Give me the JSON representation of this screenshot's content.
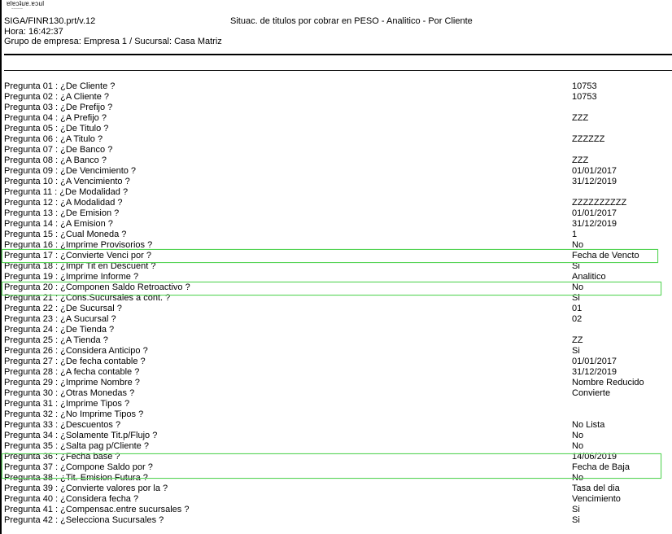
{
  "header": {
    "report_id": "SIGA/FINR130.prt/v.12",
    "title": "Situac. de titulos por cobrar en PESO - Analitico - Por Cliente",
    "time": "Hora: 16:42:37",
    "group": "Grupo de empresa: Empresa 1 / Sucursal: Casa Matriz"
  },
  "questions": [
    {
      "label": "Pregunta 01 : ¿De Cliente ?",
      "value": "10753"
    },
    {
      "label": "Pregunta 02 : ¿A Cliente ?",
      "value": "10753"
    },
    {
      "label": "Pregunta 03 : ¿De Prefijo ?",
      "value": ""
    },
    {
      "label": "Pregunta 04 : ¿A Prefijo ?",
      "value": "ZZZ"
    },
    {
      "label": "Pregunta 05 : ¿De Titulo ?",
      "value": ""
    },
    {
      "label": "Pregunta 06 : ¿A Titulo ?",
      "value": "ZZZZZZ"
    },
    {
      "label": "Pregunta 07 : ¿De Banco ?",
      "value": ""
    },
    {
      "label": "Pregunta 08 : ¿A Banco ?",
      "value": "ZZZ"
    },
    {
      "label": "Pregunta 09 : ¿De Vencimiento ?",
      "value": "01/01/2017"
    },
    {
      "label": "Pregunta 10 : ¿A Vencimiento ?",
      "value": "31/12/2019"
    },
    {
      "label": "Pregunta 11 : ¿De Modalidad ?",
      "value": ""
    },
    {
      "label": "Pregunta 12 : ¿A Modalidad ?",
      "value": "ZZZZZZZZZZ"
    },
    {
      "label": "Pregunta 13 : ¿De Emision ?",
      "value": "01/01/2017"
    },
    {
      "label": "Pregunta 14 : ¿A Emision ?",
      "value": "31/12/2019"
    },
    {
      "label": "Pregunta 15 : ¿Cual Moneda ?",
      "value": "1"
    },
    {
      "label": "Pregunta 16 : ¿Imprime Provisorios ?",
      "value": "No"
    },
    {
      "label": "Pregunta 17 : ¿Convierte Venci por ?",
      "value": "Fecha de Vencto"
    },
    {
      "label": "Pregunta 18 : ¿Impr Tit en Descuent ?",
      "value": "Si"
    },
    {
      "label": "Pregunta 19 : ¿Imprime Informe ?",
      "value": "Analitico"
    },
    {
      "label": "Pregunta 20 : ¿Componen Saldo Retroactivo ?",
      "value": "No"
    },
    {
      "label": "Pregunta 21 : ¿Cons.Sucursales a cont. ?",
      "value": "Si"
    },
    {
      "label": "Pregunta 22 : ¿De Sucursal ?",
      "value": "01"
    },
    {
      "label": "Pregunta 23 : ¿A Sucursal ?",
      "value": "02"
    },
    {
      "label": "Pregunta 24 : ¿De Tienda ?",
      "value": ""
    },
    {
      "label": "Pregunta 25 : ¿A Tienda ?",
      "value": "ZZ"
    },
    {
      "label": "Pregunta 26 : ¿Considera Anticipo ?",
      "value": "Si"
    },
    {
      "label": "Pregunta 27 : ¿De fecha contable ?",
      "value": "01/01/2017"
    },
    {
      "label": "Pregunta 28 : ¿A fecha contable ?",
      "value": "31/12/2019"
    },
    {
      "label": "Pregunta 29 : ¿Imprime Nombre ?",
      "value": "Nombre Reducido"
    },
    {
      "label": "Pregunta 30 : ¿Otras Monedas ?",
      "value": "Convierte"
    },
    {
      "label": "Pregunta 31 : ¿Imprime Tipos ?",
      "value": ""
    },
    {
      "label": "Pregunta 32 : ¿No Imprime Tipos ?",
      "value": ""
    },
    {
      "label": "Pregunta 33 : ¿Descuentos ?",
      "value": "No Lista"
    },
    {
      "label": "Pregunta 34 : ¿Solamente Tit.p/Flujo ?",
      "value": "No"
    },
    {
      "label": "Pregunta 35 : ¿Salta pag p/Cliente ?",
      "value": "No"
    },
    {
      "label": "Pregunta 36 : ¿Fecha base ?",
      "value": "14/06/2019"
    },
    {
      "label": "Pregunta 37 : ¿Compone Saldo por ?",
      "value": "Fecha de Baja"
    },
    {
      "label": "Pregunta 38 : ¿Tit. Emision Futura ?",
      "value": "No"
    },
    {
      "label": "Pregunta 39 : ¿Convierte valores por la ?",
      "value": "Tasa del dia"
    },
    {
      "label": "Pregunta 40 : ¿Considera fecha ?",
      "value": "Vencimiento"
    },
    {
      "label": "Pregunta 41 : ¿Compensac.entre sucursales ?",
      "value": "Si"
    },
    {
      "label": "Pregunta 42 : ¿Selecciona Sucursales ?",
      "value": "Si"
    }
  ],
  "highlight_color": "#56d456"
}
